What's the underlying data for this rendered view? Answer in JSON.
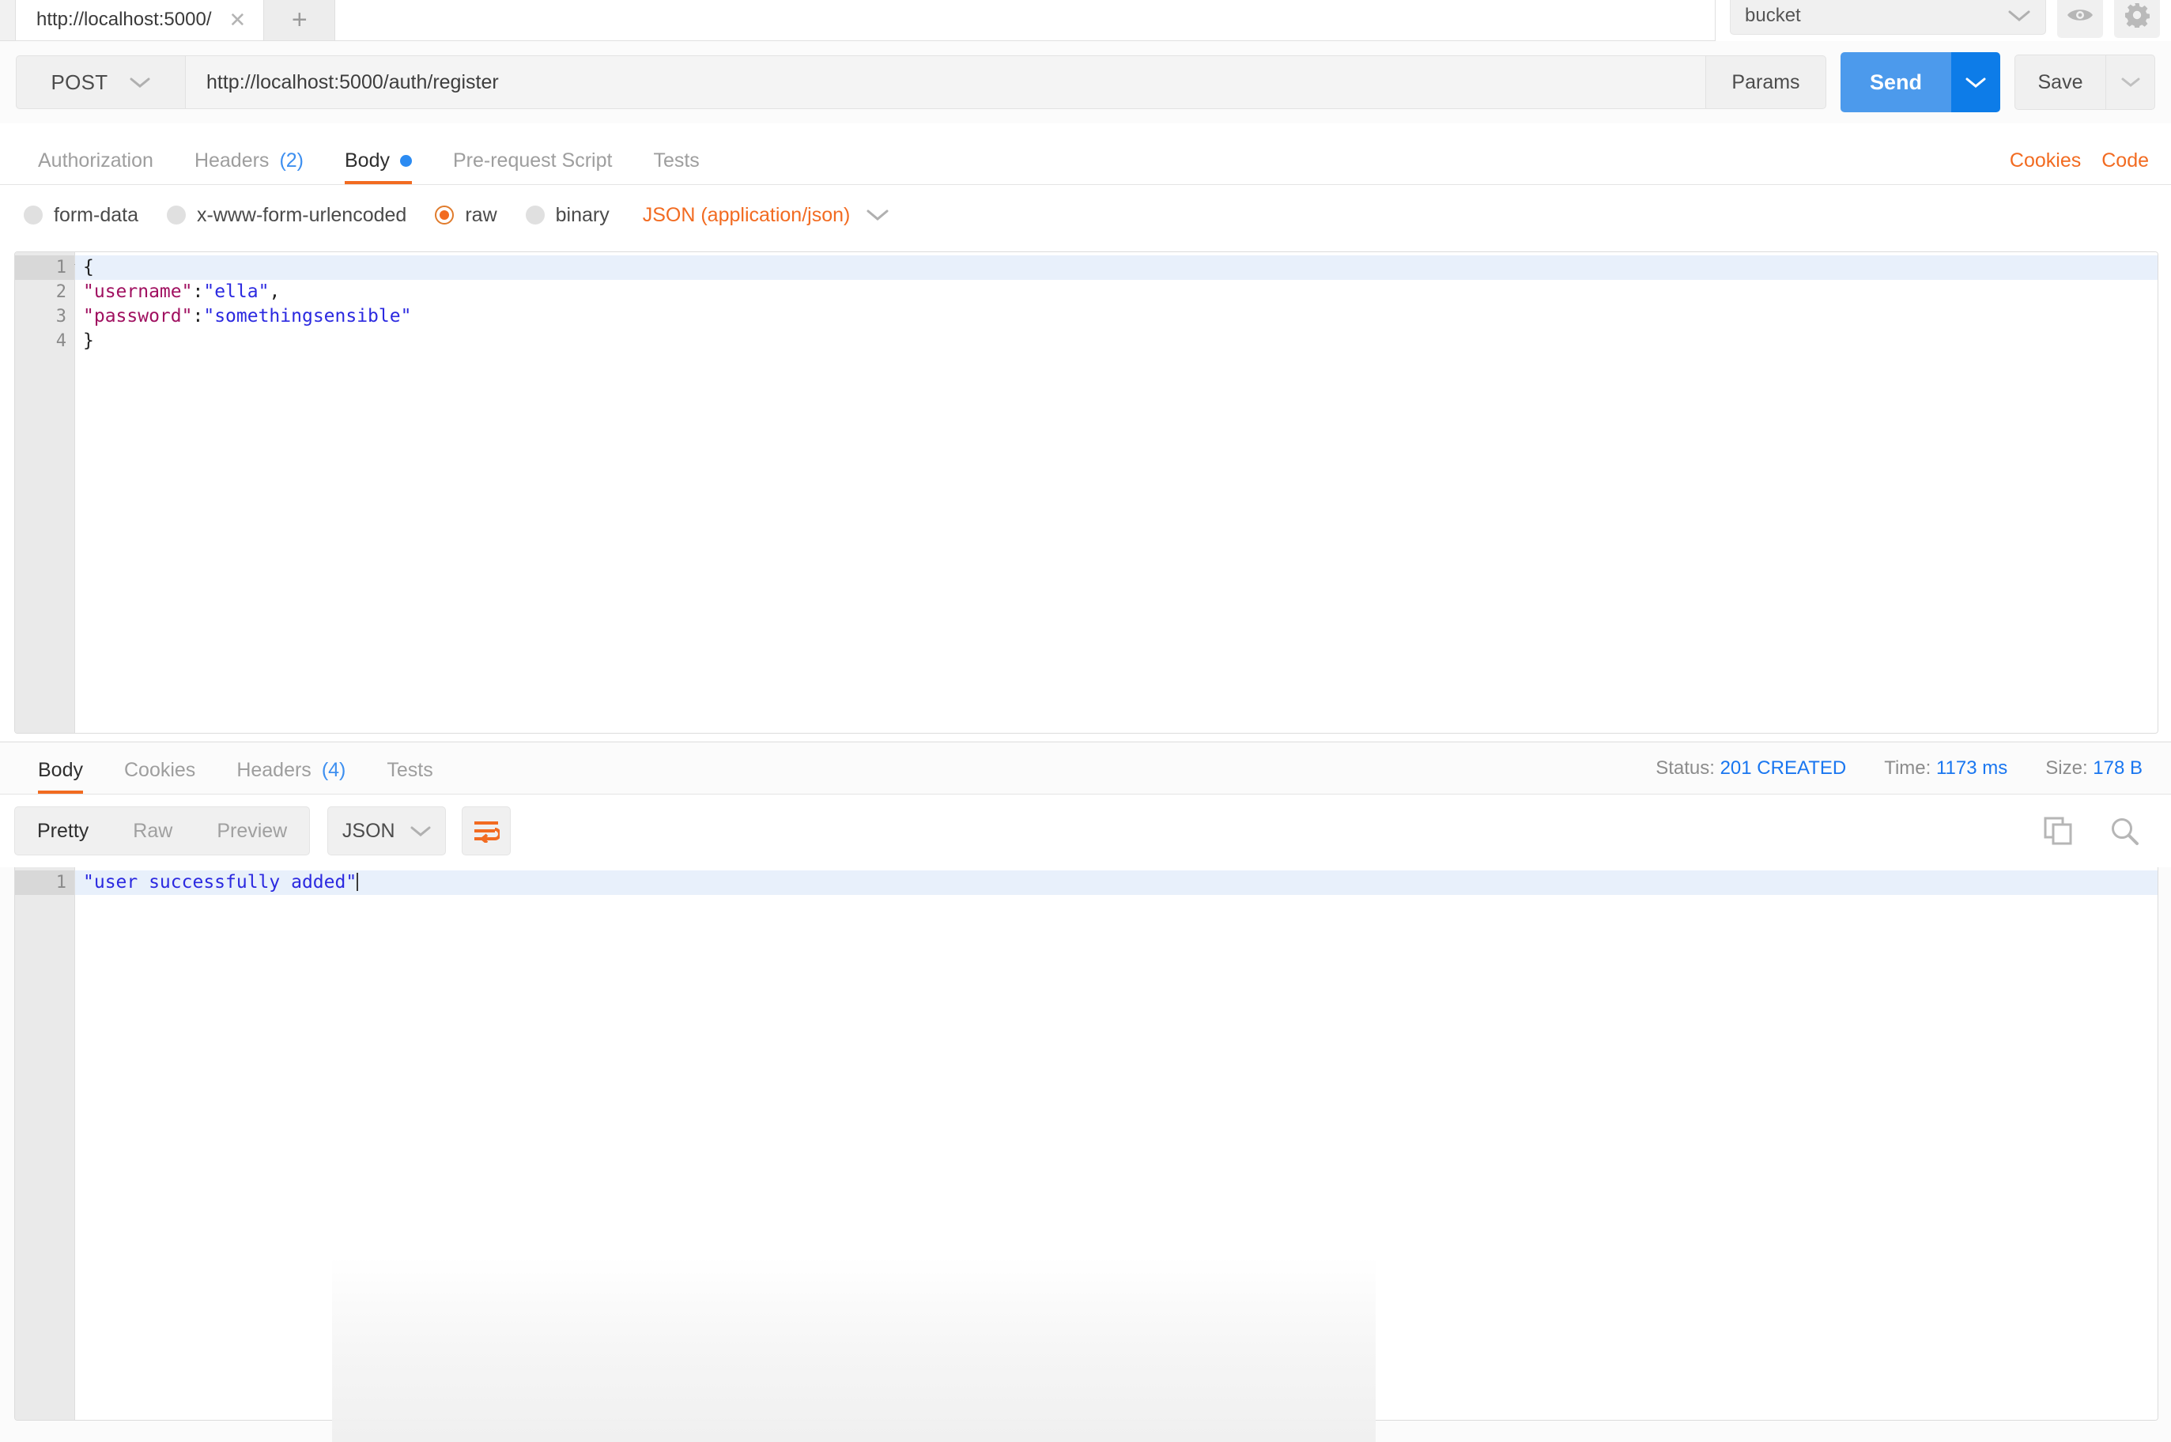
{
  "app": {
    "name": "Postman"
  },
  "tabbar": {
    "request_tab_label": "http://localhost:5000/",
    "close_icon": "close-icon",
    "new_tab_icon": "plus-icon",
    "environment_selected": "bucket",
    "eye_icon": "eye-icon",
    "settings_icon": "gear-icon"
  },
  "url_row": {
    "method": "POST",
    "url": "http://localhost:5000/auth/register",
    "url_placeholder": "Enter request URL",
    "params_label": "Params",
    "send_label": "Send",
    "save_label": "Save"
  },
  "request_tabs": {
    "items": [
      {
        "label": "Authorization",
        "count": "",
        "active": false,
        "dot": false
      },
      {
        "label": "Headers",
        "count": "(2)",
        "active": false,
        "dot": false
      },
      {
        "label": "Body",
        "count": "",
        "active": true,
        "dot": true
      },
      {
        "label": "Pre-request Script",
        "count": "",
        "active": false,
        "dot": false
      },
      {
        "label": "Tests",
        "count": "",
        "active": false,
        "dot": false
      }
    ],
    "cookies_label": "Cookies",
    "code_label": "Code"
  },
  "body_type": {
    "options": [
      {
        "label": "form-data",
        "selected": false
      },
      {
        "label": "x-www-form-urlencoded",
        "selected": false
      },
      {
        "label": "raw",
        "selected": true
      },
      {
        "label": "binary",
        "selected": false
      }
    ],
    "mime_label": "JSON (application/json)"
  },
  "request_body": {
    "lines": [
      {
        "num": "1",
        "active": true,
        "foldable": true,
        "tokens": [
          {
            "t": "punct",
            "v": "{"
          }
        ]
      },
      {
        "num": "2",
        "active": false,
        "foldable": false,
        "tokens": [
          {
            "t": "key",
            "v": "\"username\""
          },
          {
            "t": "punct",
            "v": ":"
          },
          {
            "t": "str",
            "v": "\"ella\""
          },
          {
            "t": "punct",
            "v": ","
          }
        ]
      },
      {
        "num": "3",
        "active": false,
        "foldable": false,
        "tokens": [
          {
            "t": "key",
            "v": "\"password\""
          },
          {
            "t": "punct",
            "v": ":"
          },
          {
            "t": "str",
            "v": "\"somethingsensible\""
          }
        ]
      },
      {
        "num": "4",
        "active": false,
        "foldable": false,
        "tokens": [
          {
            "t": "punct",
            "v": "}"
          }
        ]
      }
    ]
  },
  "response_tabs": {
    "items": [
      {
        "label": "Body",
        "count": "",
        "active": true
      },
      {
        "label": "Cookies",
        "count": "",
        "active": false
      },
      {
        "label": "Headers",
        "count": "(4)",
        "active": false
      },
      {
        "label": "Tests",
        "count": "",
        "active": false
      }
    ]
  },
  "response_meta": {
    "status_label": "Status:",
    "status_value": "201 CREATED",
    "time_label": "Time:",
    "time_value": "1173 ms",
    "size_label": "Size:",
    "size_value": "178 B"
  },
  "response_toolbar": {
    "views": [
      {
        "label": "Pretty",
        "active": true
      },
      {
        "label": "Raw",
        "active": false
      },
      {
        "label": "Preview",
        "active": false
      }
    ],
    "format": "JSON",
    "wrap_icon": "word-wrap-icon",
    "copy_icon": "copy-icon",
    "search_icon": "search-icon"
  },
  "response_body": {
    "lines": [
      {
        "num": "1",
        "active": true,
        "tokens": [
          {
            "t": "str",
            "v": "\"user successfully added\""
          }
        ],
        "caret": true
      }
    ]
  },
  "colors": {
    "accent_orange": "#f26b21",
    "accent_blue": "#1976f0",
    "send_blue": "#4c9aec",
    "send_caret_blue": "#0d7ce8",
    "json_key": "#a01060",
    "json_string": "#2b29e0",
    "active_line": "#e8f0fb"
  }
}
